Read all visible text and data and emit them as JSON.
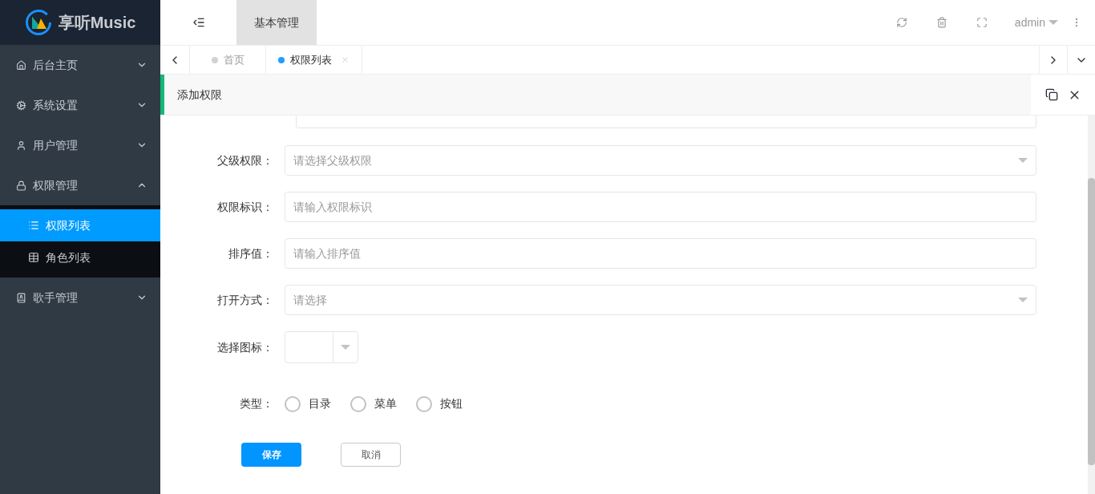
{
  "logo": {
    "text": "享听Music"
  },
  "sidebar": {
    "items": [
      {
        "label": "后台主页",
        "expanded": false
      },
      {
        "label": "系统设置",
        "expanded": false
      },
      {
        "label": "用户管理",
        "expanded": false
      },
      {
        "label": "权限管理",
        "expanded": true,
        "children": [
          {
            "label": "权限列表",
            "selected": true
          },
          {
            "label": "角色列表",
            "selected": false
          }
        ]
      },
      {
        "label": "歌手管理",
        "expanded": false
      }
    ]
  },
  "top_nav": [
    {
      "label": "基本管理",
      "selected": true
    }
  ],
  "user": {
    "name": "admin"
  },
  "tabs": [
    {
      "label": "首页",
      "selected": false
    },
    {
      "label": "权限列表",
      "selected": true
    }
  ],
  "dialog": {
    "title": "添加权限",
    "fields": [
      {
        "kind": "select",
        "label": "父级权限：",
        "placeholder": "请选择父级权限"
      },
      {
        "kind": "input",
        "label": "权限标识：",
        "placeholder": "请输入权限标识"
      },
      {
        "kind": "input",
        "label": "排序值：",
        "placeholder": "请输入排序值"
      },
      {
        "kind": "select",
        "label": "打开方式：",
        "placeholder": "请选择"
      },
      {
        "kind": "icon_select",
        "label": "选择图标："
      },
      {
        "kind": "radio",
        "label": "类型：",
        "options": [
          {
            "label": "目录",
            "selected": false
          },
          {
            "label": "菜单",
            "selected": false
          },
          {
            "label": "按钮",
            "selected": false
          }
        ]
      }
    ],
    "buttons": [
      {
        "label": "保存",
        "kind": "primary"
      },
      {
        "label": "取消",
        "kind": "default"
      }
    ]
  }
}
